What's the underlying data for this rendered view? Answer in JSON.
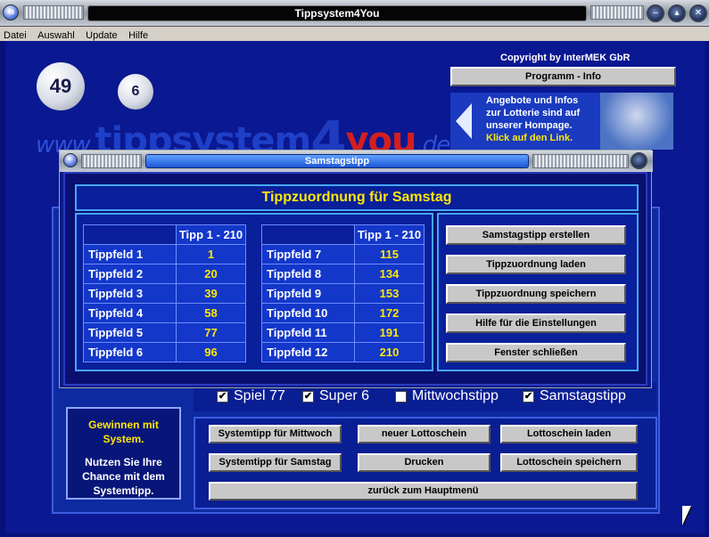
{
  "window": {
    "title": "Tippsystem4You",
    "icon_text": "49"
  },
  "menu": [
    "Datei",
    "Auswahl",
    "Update",
    "Hilfe"
  ],
  "header": {
    "balls": [
      "49",
      "6"
    ],
    "logo": {
      "www": "www.",
      "brand": "tippsystem",
      "four": "4",
      "you": "you",
      ".de": ".de"
    },
    "copyright": "Copyright by InterMEK GbR",
    "program_info_button": "Programm  -  Info",
    "promo": {
      "text": "Angebote und Infos zur Lotterie sind auf unserer Hompage.",
      "link": "Klick auf den Link."
    }
  },
  "dialog": {
    "title": "Samstagstipp",
    "heading": "Tippzuordnung für Samstag",
    "column_header": "Tipp 1 - 210",
    "left_rows": [
      {
        "label": "Tippfeld 1",
        "value": "1"
      },
      {
        "label": "Tippfeld 2",
        "value": "20"
      },
      {
        "label": "Tippfeld 3",
        "value": "39"
      },
      {
        "label": "Tippfeld 4",
        "value": "58"
      },
      {
        "label": "Tippfeld 5",
        "value": "77"
      },
      {
        "label": "Tippfeld 6",
        "value": "96"
      }
    ],
    "right_rows": [
      {
        "label": "Tippfeld 7",
        "value": "115"
      },
      {
        "label": "Tippfeld 8",
        "value": "134"
      },
      {
        "label": "Tippfeld 9",
        "value": "153"
      },
      {
        "label": "Tippfeld 10",
        "value": "172"
      },
      {
        "label": "Tippfeld 11",
        "value": "191"
      },
      {
        "label": "Tippfeld 12",
        "value": "210"
      }
    ],
    "buttons": [
      "Samstagstipp erstellen",
      "Tippzuordnung laden",
      "Tippzuordnung speichern",
      "Hilfe für die Einstellungen",
      "Fenster schließen"
    ]
  },
  "left_box": {
    "title": "Gewinnen mit System.",
    "text": "Nutzen Sie Ihre Chance mit dem Systemtipp."
  },
  "checkboxes": [
    {
      "label": "Spiel 77",
      "checked": true
    },
    {
      "label": "Super 6",
      "checked": true
    },
    {
      "label": "Mittwochstipp",
      "checked": false
    },
    {
      "label": "Samstagstipp",
      "checked": true
    }
  ],
  "bottom_buttons": {
    "systemtipp_mittwoch": "Systemtipp für Mittwoch",
    "neuer_lottoschein": "neuer Lottoschein",
    "lottoschein_laden": "Lottoschein laden",
    "systemtipp_samstag": "Systemtipp für Samstag",
    "drucken": "Drucken",
    "lottoschein_speichern": "Lottoschein speichern",
    "zurueck": "zurück zum Hauptmenü"
  },
  "colors": {
    "background": "#0a1891",
    "accent_yellow": "#ffe800",
    "panel_border": "#45a7ff",
    "button_face": "#c8c8c8"
  }
}
